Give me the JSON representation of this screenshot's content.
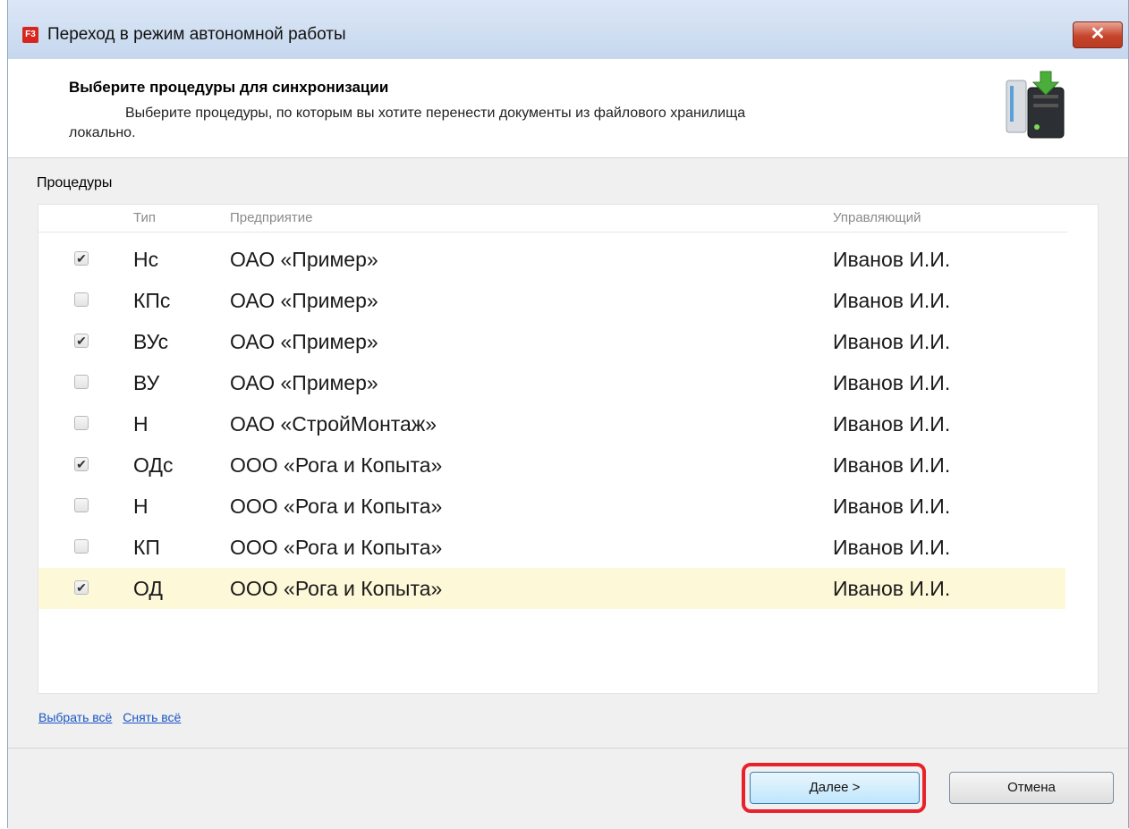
{
  "window": {
    "app_icon": "F3",
    "title": "Переход в режим автономной работы",
    "close_glyph": "✕"
  },
  "header": {
    "title": "Выберите процедуры для синхронизации",
    "description_line1": "Выберите процедуры, по которым вы хотите перенести документы из файлового хранилища",
    "description_line2": "локально.",
    "icon": "server-download-icon"
  },
  "procedures": {
    "label": "Процедуры",
    "columns": {
      "type": "Тип",
      "enterprise": "Предприятие",
      "manager": "Управляющий"
    },
    "rows": [
      {
        "checked": true,
        "type": "Нс",
        "enterprise": "ОАО «Пример»",
        "manager": "Иванов И.И."
      },
      {
        "checked": false,
        "type": "КПс",
        "enterprise": "ОАО «Пример»",
        "manager": "Иванов И.И."
      },
      {
        "checked": true,
        "type": "ВУс",
        "enterprise": "ОАО «Пример»",
        "manager": "Иванов И.И."
      },
      {
        "checked": false,
        "type": "ВУ",
        "enterprise": "ОАО «Пример»",
        "manager": "Иванов И.И."
      },
      {
        "checked": false,
        "type": "Н",
        "enterprise": "ОАО «СтройМонтаж»",
        "manager": "Иванов И.И."
      },
      {
        "checked": true,
        "type": "ОДс",
        "enterprise": "ООО «Рога и Копыта»",
        "manager": "Иванов И.И."
      },
      {
        "checked": false,
        "type": "Н",
        "enterprise": "ООО «Рога и Копыта»",
        "manager": "Иванов И.И."
      },
      {
        "checked": false,
        "type": "КП",
        "enterprise": "ООО «Рога и Копыта»",
        "manager": "Иванов И.И."
      },
      {
        "checked": true,
        "type": "ОД",
        "enterprise": "ООО «Рога и Копыта»",
        "manager": "Иванов И.И.",
        "selected": true
      }
    ]
  },
  "links": {
    "select_all": "Выбрать всё",
    "clear_all": "Снять всё"
  },
  "footer": {
    "next_label": "Далее >",
    "cancel_label": "Отмена"
  },
  "colors": {
    "highlight": "#e8212b",
    "selected_row": "#fdf8d8",
    "link": "#1a56c4"
  }
}
